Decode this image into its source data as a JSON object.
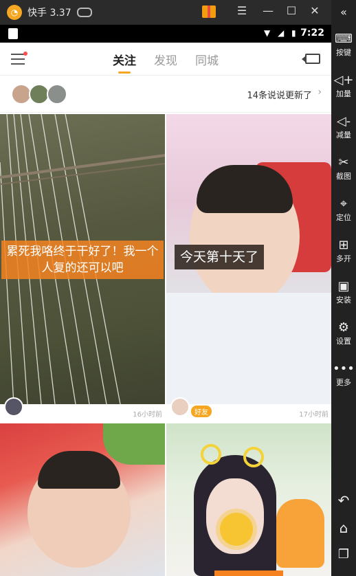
{
  "emulator": {
    "app_name": "快手 3.37",
    "controls": {
      "menu": "☰",
      "minimize": "—",
      "maximize": "☐",
      "close": "✕"
    }
  },
  "status_bar": {
    "time": "7:22"
  },
  "sidebar": {
    "collapse": "«",
    "items": [
      {
        "label": "按键",
        "icon": "keyboard-icon"
      },
      {
        "label": "加量",
        "icon": "volume-up-icon"
      },
      {
        "label": "减量",
        "icon": "volume-down-icon"
      },
      {
        "label": "截图",
        "icon": "scissors-icon"
      },
      {
        "label": "定位",
        "icon": "location-icon"
      },
      {
        "label": "多开",
        "icon": "multi-open-icon"
      },
      {
        "label": "安装",
        "icon": "apk-icon"
      },
      {
        "label": "设置",
        "icon": "gear-icon"
      },
      {
        "label": "更多",
        "icon": "more-icon"
      }
    ],
    "back": "↶",
    "home": "⌂",
    "recent": "❐"
  },
  "nav": {
    "tabs": [
      {
        "label": "关注",
        "active": true
      },
      {
        "label": "发现"
      },
      {
        "label": "同城"
      }
    ]
  },
  "updates": {
    "text": "14条说说更新了",
    "arrow": "›"
  },
  "feed": [
    {
      "caption": "累死我咯终于干好了！我一个人复的还可以吧",
      "time": "16小时前",
      "badge": ""
    },
    {
      "caption": "今天第十天了",
      "time": "17小时前",
      "badge": "好友"
    },
    {
      "caption": "",
      "time": "",
      "badge": ""
    },
    {
      "caption": "",
      "time": "",
      "badge": ""
    }
  ],
  "colors": {
    "accent": "#f5a623",
    "badge_dot": "#ff4d4f"
  }
}
